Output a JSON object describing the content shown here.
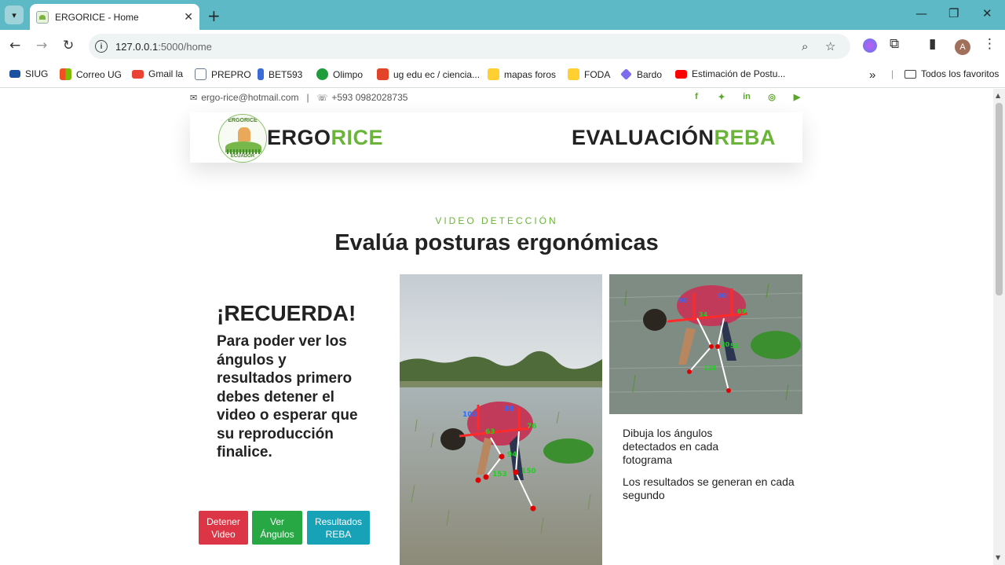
{
  "browser": {
    "tab_title": "ERGORICE - Home",
    "url_host": "127.0.0.1",
    "url_path": ":5000/home",
    "profile_initial": "A"
  },
  "bookmarks": [
    {
      "label": "SIUG",
      "icon": "ug-icon",
      "color": "#1b4fa0"
    },
    {
      "label": "Correo UG",
      "icon": "windows-icon",
      "color": "#f25022"
    },
    {
      "label": "Gmail la",
      "icon": "gmail-icon",
      "color": "#ea4335"
    },
    {
      "label": "PREPRO",
      "icon": "document-icon",
      "color": "#6b7b8c"
    },
    {
      "label": "BET593",
      "icon": "bet-icon",
      "color": "#3a6bd8"
    },
    {
      "label": "Olimpo",
      "icon": "olimpo-icon",
      "color": "#1e9d3a"
    },
    {
      "label": "ug edu ec / ciencia...",
      "icon": "gitlab-icon",
      "color": "#e24329"
    },
    {
      "label": "mapas foros",
      "icon": "miro-icon",
      "color": "#ffd02f"
    },
    {
      "label": "FODA",
      "icon": "miro-icon",
      "color": "#ffd02f"
    },
    {
      "label": "Bardo",
      "icon": "bard-icon",
      "color": "#7b6cf0"
    },
    {
      "label": "Estimación de Postu...",
      "icon": "youtube-icon",
      "color": "#ff0000"
    }
  ],
  "bookmarks_more": "»",
  "bookmarks_all": "Todos los favoritos",
  "topbar": {
    "email": "ergo-rice@hotmail.com",
    "separator": "|",
    "phone": "+593 0982028735"
  },
  "social": [
    "f",
    "t",
    "in",
    "ig",
    "yt"
  ],
  "logo": {
    "text_top": "ERGORICE",
    "text_bottom": "ECUADOR"
  },
  "brand": {
    "part1": "ERGO",
    "part2": "RICE"
  },
  "brand_right": {
    "part1": "EVALUACIÓN",
    "part2": "REBA"
  },
  "section": {
    "kicker": "VIDEO DETECCIÓN",
    "title": "Evalúa posturas ergonómicas"
  },
  "reminder": {
    "title": "¡RECUERDA!",
    "text": "Para poder ver los ángulos y resultados primero debes detener el video o esperar que su reproducción finalice."
  },
  "buttons": {
    "stop": "Detener Video",
    "angles": "Ver Ángulos",
    "results": "Resultados REBA"
  },
  "descriptions": {
    "first": "Dibuja los ángulos detectados en cada fotograma",
    "second": "Los resultados se generan en cada segundo"
  },
  "video_labels": [
    "103",
    "88",
    "63",
    "76",
    "94",
    "153",
    "150"
  ],
  "thumb_labels": [
    "98",
    "98",
    "34",
    "69",
    "20",
    "51",
    "128"
  ],
  "colors": {
    "accent": "#6bb43a",
    "chrome": "#5eb9c6",
    "danger": "#dc3545",
    "success": "#28a745",
    "info": "#17a2b8"
  }
}
